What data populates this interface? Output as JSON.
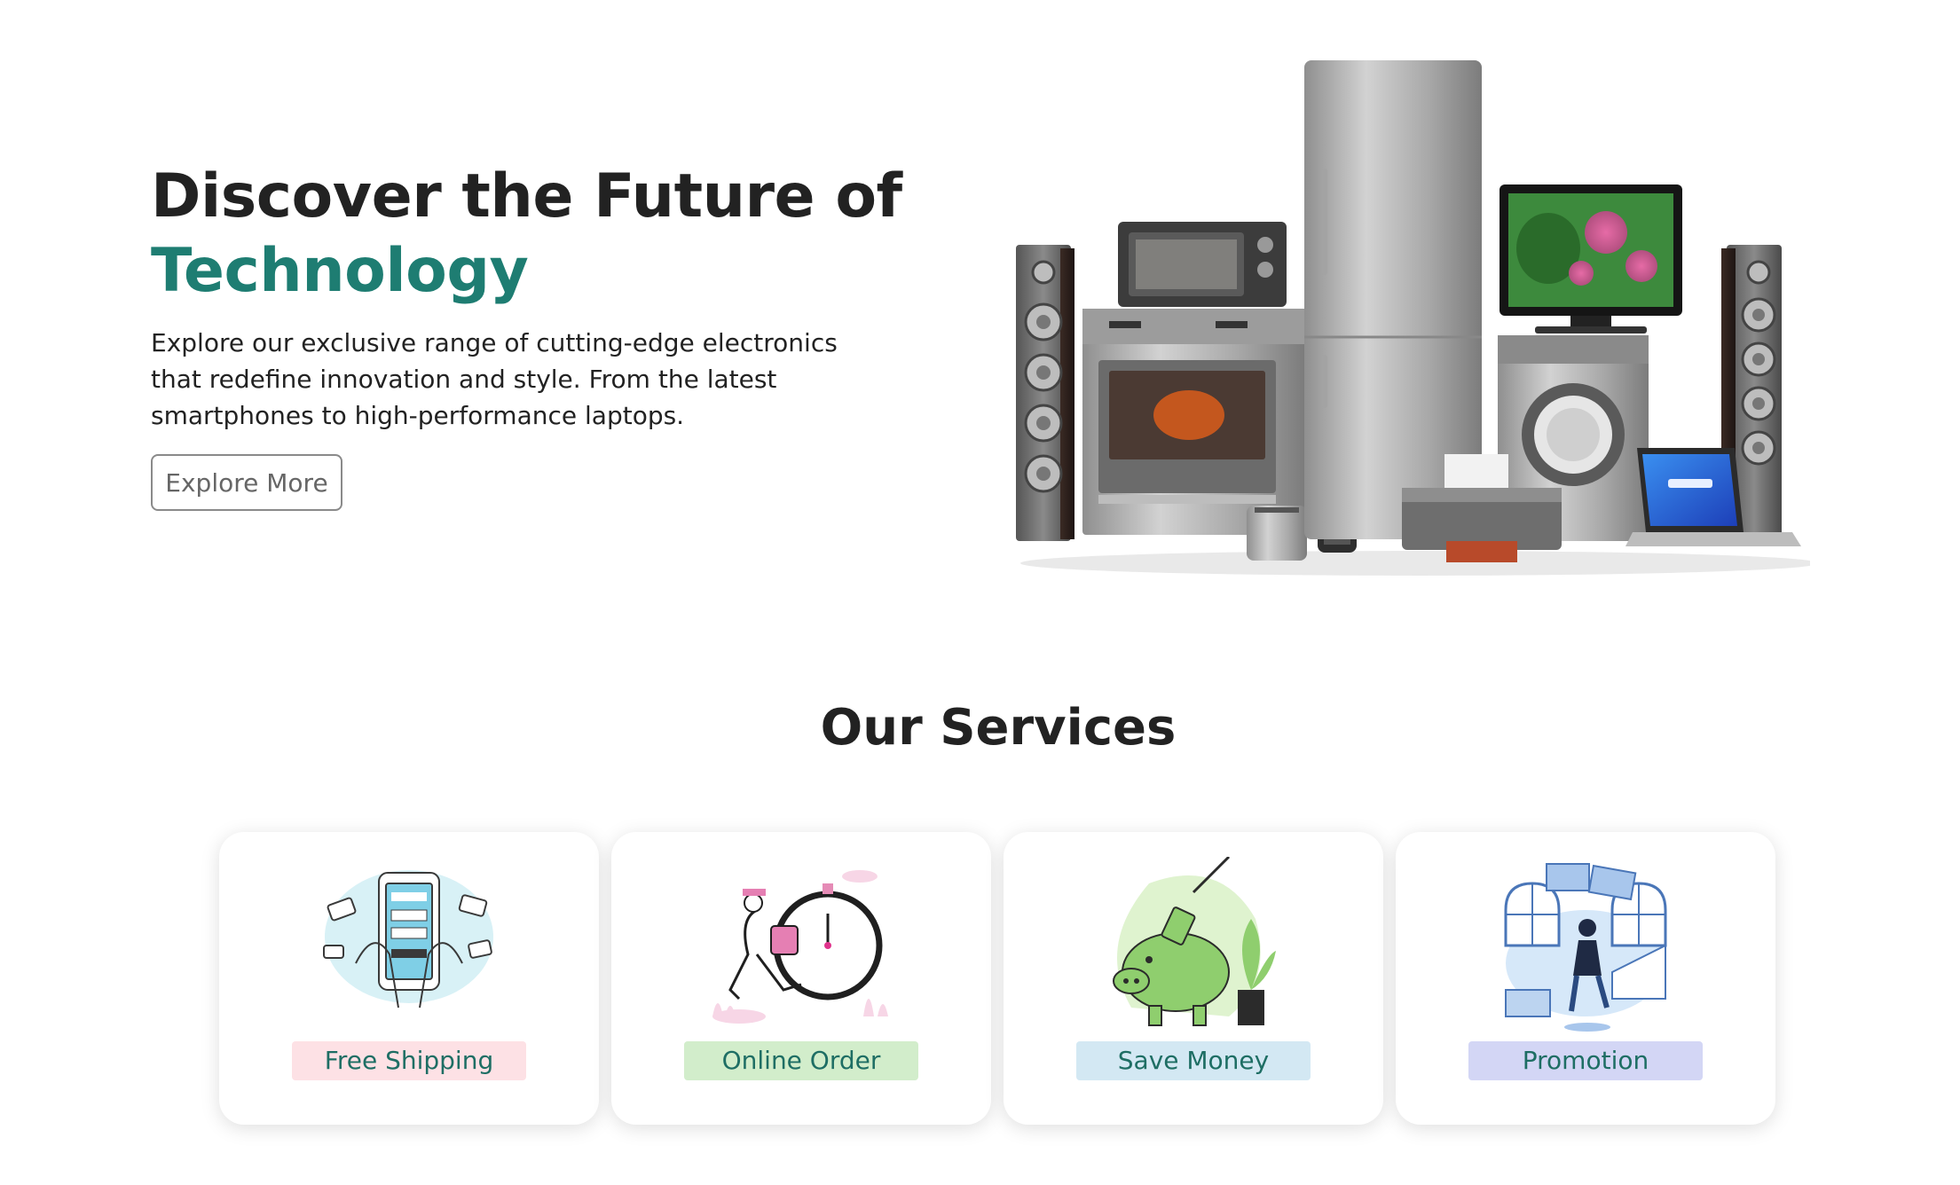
{
  "hero": {
    "title_line1": "Discover the Future of",
    "title_line2": "Technology",
    "description": "Explore our exclusive range of cutting-edge electronics that redefine innovation and style. From the latest smartphones to high-performance laptops.",
    "cta_label": "Explore More"
  },
  "services": {
    "heading": "Our Services",
    "items": [
      {
        "label": "Free Shipping",
        "icon": "phone-payment-illustration",
        "badge_color": "#fde1e5"
      },
      {
        "label": "Online Order",
        "icon": "delivery-clock-illustration",
        "badge_color": "#d2edcb"
      },
      {
        "label": "Save Money",
        "icon": "piggy-bank-illustration",
        "badge_color": "#d3e8f3"
      },
      {
        "label": "Promotion",
        "icon": "gift-promotion-illustration",
        "badge_color": "#d3d6f5"
      }
    ]
  },
  "colors": {
    "accent": "#1e7d72",
    "label_text": "#1e6e64",
    "heading": "#222222"
  }
}
